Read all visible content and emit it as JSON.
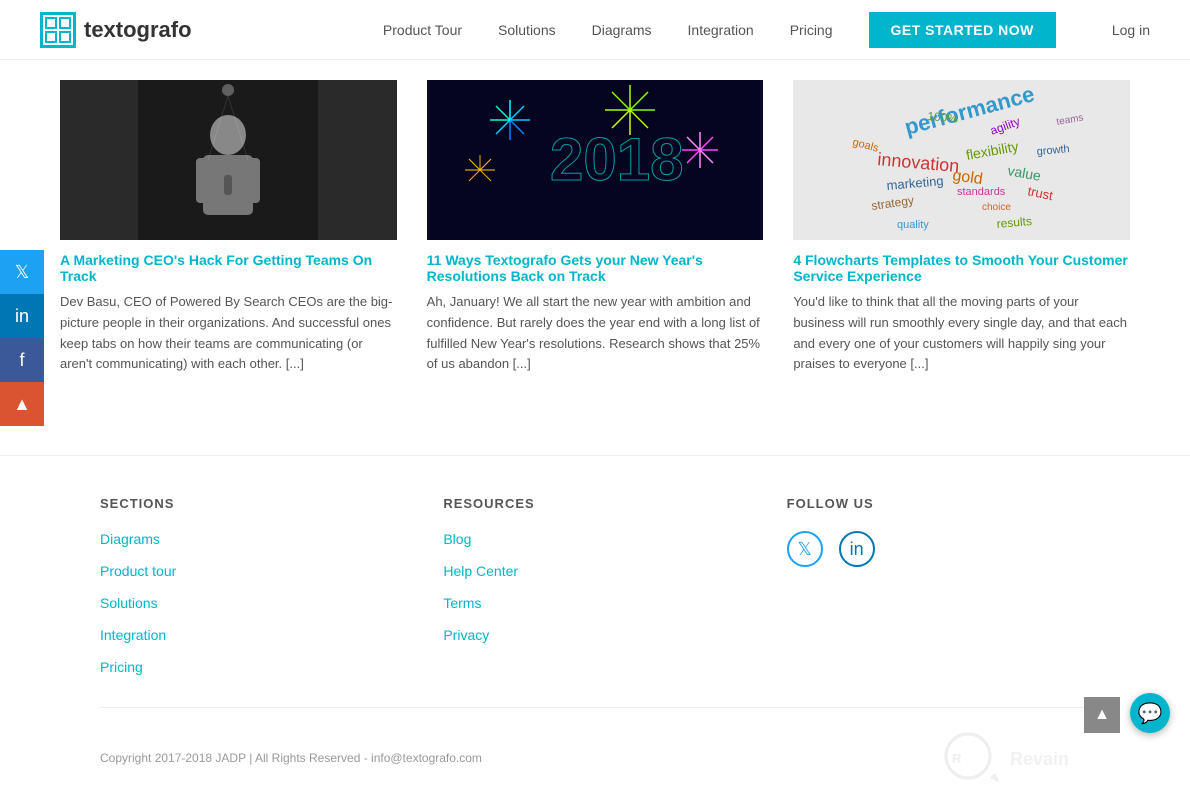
{
  "header": {
    "logo_symbol": "#",
    "logo_text": "textografo",
    "nav_items": [
      {
        "label": "Product Tour",
        "href": "#"
      },
      {
        "label": "Solutions",
        "href": "#"
      },
      {
        "label": "Diagrams",
        "href": "#"
      },
      {
        "label": "Integration",
        "href": "#"
      },
      {
        "label": "Pricing",
        "href": "#"
      }
    ],
    "cta_label": "GET STARTED NOW",
    "login_label": "Log in"
  },
  "social_sidebar": {
    "twitter_label": "𝕏",
    "linkedin_label": "in",
    "facebook_label": "f",
    "producthunt_label": "▲"
  },
  "articles": [
    {
      "img_type": "person",
      "title": "A Marketing CEO's Hack For Getting Teams On Track",
      "excerpt": "Dev Basu, CEO of Powered By Search   CEOs are the big-picture people in their organizations. And successful ones keep tabs on how their teams are communicating (or aren't communicating) with each other. [...]"
    },
    {
      "img_type": "fireworks",
      "title": "11 Ways Textografo Gets your New Year's Resolutions Back on Track",
      "excerpt": "Ah, January! We all start the new year with ambition and confidence. But rarely does the year end with a long list of fulfilled New Year's resolutions. Research shows that 25% of us abandon [...]"
    },
    {
      "img_type": "wordcloud",
      "title": "4 Flowcharts Templates to Smooth Your Customer Service Experience",
      "excerpt": "You'd like to think that all the moving parts of your business will run smoothly every single day, and that each and every one of your customers will happily sing your praises to everyone [...]"
    }
  ],
  "footer": {
    "sections_title": "SECTIONS",
    "sections_links": [
      {
        "label": "Diagrams",
        "href": "#"
      },
      {
        "label": "Product tour",
        "href": "#"
      },
      {
        "label": "Solutions",
        "href": "#"
      },
      {
        "label": "Integration",
        "href": "#"
      },
      {
        "label": "Pricing",
        "href": "#"
      }
    ],
    "resources_title": "RESOURCES",
    "resources_links": [
      {
        "label": "Blog",
        "href": "#"
      },
      {
        "label": "Help Center",
        "href": "#"
      },
      {
        "label": "Terms",
        "href": "#"
      },
      {
        "label": "Privacy",
        "href": "#"
      }
    ],
    "follow_title": "FOLLOW US",
    "copyright": "Copyright 2017-2018 JADP | All Rights Reserved - info@textografo.com"
  }
}
